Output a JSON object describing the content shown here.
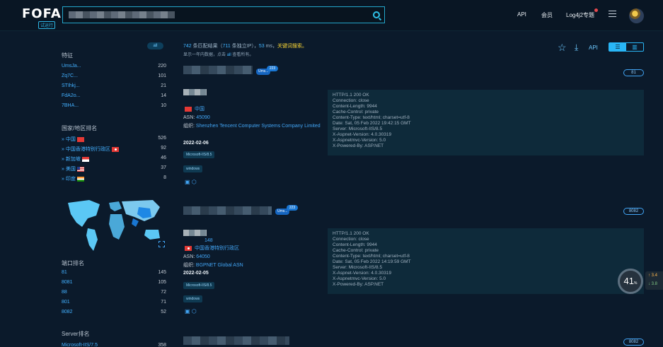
{
  "header": {
    "logo": "FOFA",
    "badge": "试运行",
    "nav": [
      "API",
      "会员",
      "Log4j2专题"
    ]
  },
  "sidebar": {
    "all_label": "all",
    "features_title": "特征",
    "features": [
      {
        "name": "UmsJa...",
        "count": "220"
      },
      {
        "name": "Zq7C...",
        "count": "101"
      },
      {
        "name": "STIhkj...",
        "count": "21"
      },
      {
        "name": "FdA2o...",
        "count": "14"
      },
      {
        "name": "7BHA...",
        "count": "10"
      }
    ],
    "countries_title": "国家/地区排名",
    "countries": [
      {
        "name": "中国",
        "count": "526",
        "flag": "cn"
      },
      {
        "name": "中国香港特别行政区",
        "count": "92",
        "flag": "hk"
      },
      {
        "name": "新加坡",
        "count": "46",
        "flag": "sg"
      },
      {
        "name": "美国",
        "count": "37",
        "flag": "us"
      },
      {
        "name": "印度",
        "count": "8",
        "flag": "in"
      }
    ],
    "ports_title": "端口排名",
    "ports": [
      {
        "name": "81",
        "count": "145"
      },
      {
        "name": "8081",
        "count": "105"
      },
      {
        "name": "88",
        "count": "72"
      },
      {
        "name": "801",
        "count": "71"
      },
      {
        "name": "8082",
        "count": "52"
      }
    ],
    "server_title": "Server排名",
    "servers": [
      {
        "name": "Microsoft-IIS/7.5",
        "count": "358"
      }
    ]
  },
  "summary": {
    "count": "742",
    "text1": "条匹配结果",
    "paren_open": "（",
    "unique": "711",
    "text2": "条独立IP）",
    "sep": "，",
    "time": "53",
    "unit": "ms，",
    "warn": "关键词搜索。",
    "line2_prefix": "显示一年内数据，点击",
    "line2_all": "all",
    "line2_suffix": "查看所有。"
  },
  "toolbar": {
    "api_label": "API"
  },
  "results": [
    {
      "ums_label": "Ums...",
      "ums_count": "223",
      "port": "81",
      "country": "中国",
      "asn_label": "ASN:",
      "asn": "45090",
      "org_label": "组织:",
      "org": "Shenzhen Tencent Computer Systems Company Limited",
      "date": "2022-02-06",
      "tags": [
        "Microsoft-IIS/8.5",
        "windows"
      ],
      "headers": [
        "HTTP/1.1 200 OK",
        "Connection: close",
        "Content-Length: 9944",
        "Cache-Control: private",
        "Content-Type: text/html; charset=utf-8",
        "Date: Sat, 05 Feb 2022 19:42:15 GMT",
        "Server: Microsoft-IIS/8.5",
        "X-Aspnet-Version: 4.0.30319",
        "X-Aspnetmvc-Version: 5.0",
        "X-Powered-By: ASP.NET"
      ]
    },
    {
      "ums_label": "Ums...",
      "ums_count": "223",
      "port": "8082",
      "ip_suffix": "148",
      "country": "中国香港特别行政区",
      "asn_label": "ASN:",
      "asn": "64050",
      "org_label": "组织:",
      "org": "BGPNET Global ASN",
      "date": "2022-02-05",
      "tags": [
        "Microsoft-IIS/8.5",
        "windows"
      ],
      "headers": [
        "HTTP/1.1 200 OK",
        "Connection: close",
        "Content-Length: 9944",
        "Cache-Control: private",
        "Content-Type: text/html; charset=utf-8",
        "Date: Sat, 05 Feb 2022 14:19:59 GMT",
        "Server: Microsoft-IIS/8.5",
        "X-Aspnet-Version: 4.0.30319",
        "X-Aspnetmvc-Version: 5.0",
        "X-Powered-By: ASP.NET"
      ]
    },
    {
      "port": "8082"
    }
  ],
  "gauge": {
    "value": "41",
    "unit": "%",
    "up": "3.4",
    "down": "3.8"
  }
}
